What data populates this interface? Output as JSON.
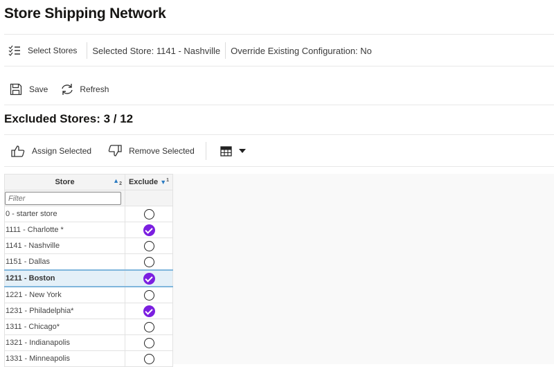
{
  "page": {
    "title": "Store Shipping Network"
  },
  "toolbar_top": {
    "select_stores_label": "Select Stores",
    "selected_store": "Selected Store: 1141 - Nashville",
    "override": "Override Existing Configuration: No"
  },
  "toolbar_actions": {
    "save_label": "Save",
    "refresh_label": "Refresh"
  },
  "section": {
    "title": "Excluded Stores: 3 / 12"
  },
  "grid_toolbar": {
    "assign_label": "Assign Selected",
    "remove_label": "Remove Selected"
  },
  "grid": {
    "columns": [
      {
        "label": "Store",
        "sort": "ascending",
        "sort_order": "2"
      },
      {
        "label": "Exclude",
        "sort": "descending",
        "sort_order": "1"
      }
    ],
    "filter_placeholder": "Filter",
    "rows": [
      {
        "store": "0 - starter store",
        "exclude": false
      },
      {
        "store": "1111 - Charlotte *",
        "exclude": true
      },
      {
        "store": "1141 - Nashville",
        "exclude": false
      },
      {
        "store": "1151 - Dallas",
        "exclude": false
      },
      {
        "store": "1211 - Boston",
        "exclude": true,
        "selected": true
      },
      {
        "store": "1221 - New York",
        "exclude": false
      },
      {
        "store": "1231 - Philadelphia*",
        "exclude": true
      },
      {
        "store": "1311 - Chicago*",
        "exclude": false
      },
      {
        "store": "1321 - Indianapolis",
        "exclude": false
      },
      {
        "store": "1331 - Minneapolis",
        "exclude": false
      }
    ]
  },
  "colors": {
    "accent": "#7b1fe0",
    "sort_icon": "#2a7bc2",
    "selected_row": "#e4f0f8"
  }
}
